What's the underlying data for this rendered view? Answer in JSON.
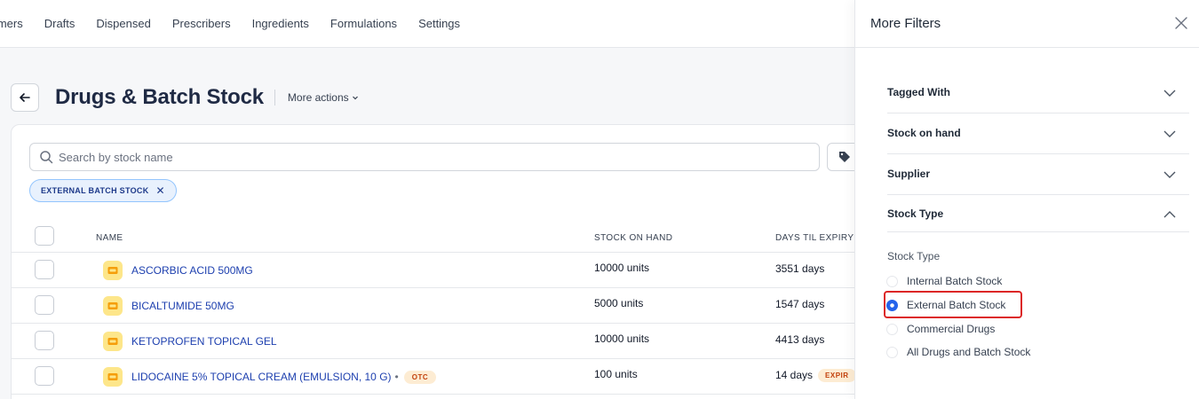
{
  "nav": {
    "items": [
      "tomers",
      "Drafts",
      "Dispensed",
      "Prescribers",
      "Ingredients",
      "Formulations",
      "Settings"
    ]
  },
  "header": {
    "title": "Drugs & Batch Stock",
    "more_actions": "More actions",
    "back_icon": "arrow-left-icon"
  },
  "search": {
    "placeholder": "Search by stock name"
  },
  "filter_chip": {
    "label": "EXTERNAL BATCH STOCK"
  },
  "table": {
    "columns": [
      "NAME",
      "STOCK ON HAND",
      "DAYS TIL EXPIRY"
    ],
    "rows": [
      {
        "name": "ASCORBIC ACID 500MG",
        "stock": "10000 units",
        "days": "3551 days"
      },
      {
        "name": "BICALTUMIDE 50MG",
        "stock": "5000 units",
        "days": "1547 days"
      },
      {
        "name": "KETOPROFEN TOPICAL GEL",
        "stock": "10000 units",
        "days": "4413 days"
      },
      {
        "name": "LIDOCAINE 5% TOPICAL CREAM (EMULSION, 10 G)",
        "badge": "OTC",
        "stock": "100 units",
        "days": "14 days",
        "expiry_badge": "EXPIR"
      }
    ]
  },
  "panel": {
    "title": "More Filters",
    "sections": [
      "Tagged With",
      "Stock on hand",
      "Supplier",
      "Stock Type"
    ],
    "stock_type_label": "Stock Type",
    "options": [
      "Internal Batch Stock",
      "External Batch Stock",
      "Commercial Drugs",
      "All Drugs and Batch Stock"
    ],
    "selected_option": "External Batch Stock"
  },
  "colors": {
    "accent": "#2563eb",
    "link": "#1e40af",
    "badge_bg": "#fdecd3",
    "badge_text": "#c2410c",
    "highlight": "#dc2626"
  }
}
